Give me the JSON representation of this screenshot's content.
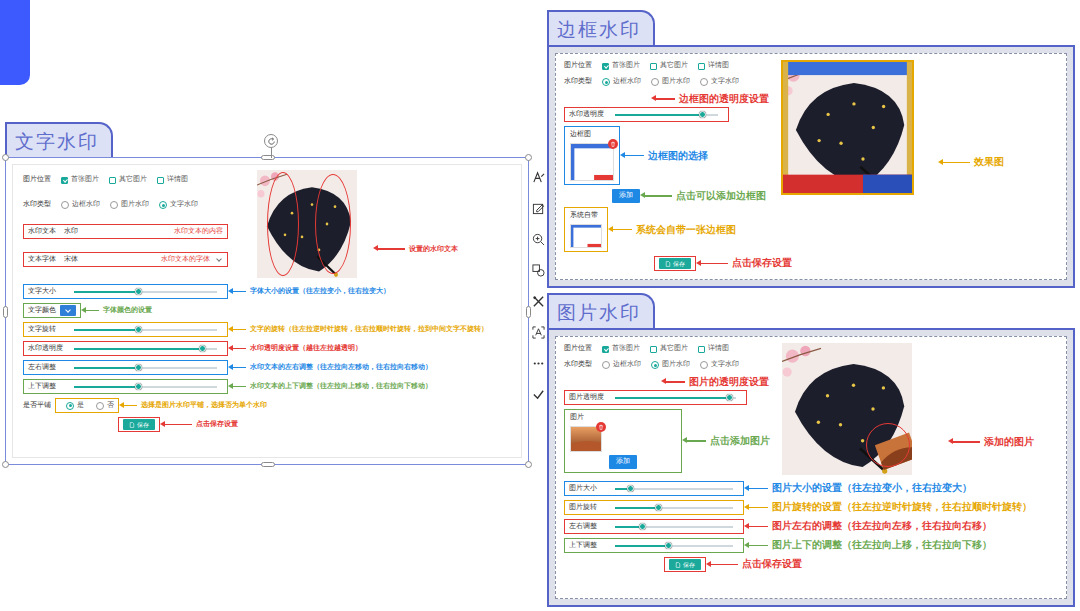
{
  "panels": [
    {
      "title": "文字水印",
      "top_rows": [
        {
          "kind": "checks",
          "label": "图片位置",
          "options": [
            {
              "label": "首张图片",
              "checked": true
            },
            {
              "label": "其它图片",
              "checked": false
            },
            {
              "label": "详情图",
              "checked": false
            }
          ]
        },
        {
          "kind": "radios",
          "label": "水印类型",
          "options": [
            {
              "label": "边框水印",
              "selected": false
            },
            {
              "label": "图片水印",
              "selected": false
            },
            {
              "label": "文字水印",
              "selected": true
            }
          ]
        },
        {
          "kind": "input",
          "label": "水印文本",
          "value": "水印",
          "note": {
            "text": "水印文本的内容",
            "color": "#e53935"
          }
        },
        {
          "kind": "select",
          "label": "文本字体",
          "value": "宋体",
          "note": {
            "text": "水印文本的字体",
            "color": "#e53935"
          }
        }
      ],
      "preview": {
        "kind": "text",
        "note": {
          "text": "设置的水印文本",
          "color": "#e53935"
        }
      },
      "rows": [
        {
          "kind": "slider",
          "label": "文字大小",
          "level": 0.45,
          "note": {
            "text": "字体大小的设置（往左拉变小，往右拉变大）",
            "color": "#1e88e5"
          }
        },
        {
          "kind": "color",
          "label": "文字颜色",
          "color": "#2f7fd8",
          "note": {
            "text": "字体颜色的设置",
            "color": "#6aa84f"
          }
        },
        {
          "kind": "slider",
          "label": "文字旋转",
          "level": 0.45,
          "note": {
            "text": "文字的旋转（往左拉逆时针旋转，往右拉顺时针旋转，拉到中间文字不旋转）",
            "color": "#e6a700"
          }
        },
        {
          "kind": "slider",
          "label": "水印透明度",
          "level": 0.9,
          "note": {
            "text": "水印透明度设置（越往左拉越透明）",
            "color": "#e53935"
          }
        },
        {
          "kind": "slider",
          "label": "左右调整",
          "level": 0.45,
          "note": {
            "text": "水印文本的左右调整（往左拉向左移动，往右拉向右移动）",
            "color": "#1e88e5"
          }
        },
        {
          "kind": "slider",
          "label": "上下调整",
          "level": 0.45,
          "note": {
            "text": "水印文本的上下调整（往左拉向上移动，往右拉向下移动）",
            "color": "#6aa84f"
          }
        },
        {
          "kind": "radios",
          "label": "是否平铺",
          "options": [
            {
              "label": "是",
              "selected": true
            },
            {
              "label": "否",
              "selected": false
            }
          ],
          "note": {
            "text": "选择是图片水印平铺，选择否为单个水印",
            "color": "#e6a700"
          }
        },
        {
          "kind": "save",
          "text": "保存",
          "note": {
            "text": "点击保存设置",
            "color": "#e53935"
          }
        }
      ]
    },
    {
      "title": "边框水印",
      "top_rows": [
        {
          "kind": "checks",
          "label": "图片位置",
          "options": [
            {
              "label": "首张图片",
              "checked": true
            },
            {
              "label": "其它图片",
              "checked": false
            },
            {
              "label": "详情图",
              "checked": false
            }
          ]
        },
        {
          "kind": "radios",
          "label": "水印类型",
          "options": [
            {
              "label": "边框水印",
              "selected": true
            },
            {
              "label": "图片水印",
              "selected": false
            },
            {
              "label": "文字水印",
              "selected": false
            }
          ]
        },
        {
          "kind": "slider",
          "label": "水印透明度",
          "level": 0.85,
          "note": {
            "text": "边框图的透明度设置",
            "color": "#e53935"
          }
        },
        {
          "kind": "tile",
          "label": "边框图",
          "removable": true,
          "note": {
            "text": "边框图的选择",
            "color": "#1e88e5"
          }
        },
        {
          "kind": "add",
          "text": "添加",
          "note": {
            "text": "点击可以添加边框图",
            "color": "#6aa84f"
          }
        },
        {
          "kind": "tile",
          "label": "系统自带",
          "removable": false,
          "note": {
            "text": "系统会自带一张边框图",
            "color": "#e6a700"
          }
        },
        {
          "kind": "save",
          "text": "保存",
          "note": {
            "text": "点击保存设置",
            "color": "#e53935"
          }
        }
      ],
      "preview": {
        "kind": "frame",
        "note": {
          "text": "效果图",
          "color": "#e6a700"
        }
      }
    },
    {
      "title": "图片水印",
      "top_rows": [
        {
          "kind": "checks",
          "label": "图片位置",
          "options": [
            {
              "label": "首张图片",
              "checked": true
            },
            {
              "label": "其它图片",
              "checked": false
            },
            {
              "label": "详情图",
              "checked": false
            }
          ]
        },
        {
          "kind": "radios",
          "label": "水印类型",
          "options": [
            {
              "label": "边框水印",
              "selected": false
            },
            {
              "label": "图片水印",
              "selected": true
            },
            {
              "label": "文字水印",
              "selected": false
            }
          ]
        },
        {
          "kind": "slider",
          "label": "图片透明度",
          "level": 0.95,
          "note": {
            "text": "图片的透明度设置",
            "color": "#e53935"
          }
        },
        {
          "kind": "tile",
          "label": "图片",
          "removable": true,
          "button": "添加",
          "note": {
            "text": "点击添加图片",
            "color": "#6aa84f"
          }
        }
      ],
      "preview": {
        "kind": "image",
        "note": {
          "text": "添加的图片",
          "color": "#e53935"
        }
      },
      "rows": [
        {
          "kind": "slider",
          "label": "图片大小",
          "level": 0.13,
          "note": {
            "text": "图片大小的设置（往左拉变小，往右拉变大）",
            "color": "#1e88e5"
          }
        },
        {
          "kind": "slider",
          "label": "图片旋转",
          "level": 0.37,
          "note": {
            "text": "图片旋转的设置（往左拉逆时针旋转，往右拉顺时针旋转）",
            "color": "#e6a700"
          }
        },
        {
          "kind": "slider",
          "label": "左右调整",
          "level": 0.23,
          "note": {
            "text": "图片左右的调整（往左拉向左移，往右拉向右移）",
            "color": "#e53935"
          }
        },
        {
          "kind": "slider",
          "label": "上下调整",
          "level": 0.45,
          "note": {
            "text": "图片上下的调整（往左拉向上移，往右拉向下移）",
            "color": "#6aa84f"
          }
        },
        {
          "kind": "save",
          "text": "保存",
          "note": {
            "text": "点击保存设置",
            "color": "#e53935"
          }
        }
      ]
    }
  ]
}
